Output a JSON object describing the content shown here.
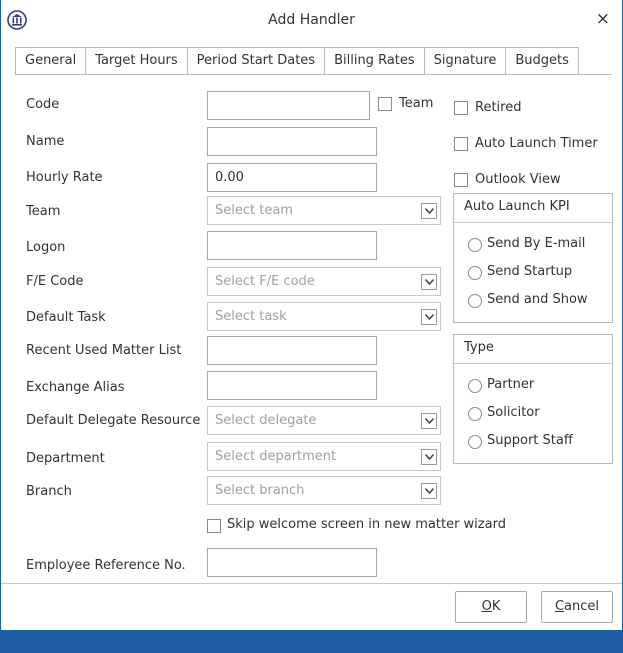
{
  "window": {
    "title": "Add Handler",
    "close_glyph": "×",
    "app_icon": "pillars-logo-icon",
    "accent_color": "#1e5ea8"
  },
  "tabs": [
    {
      "label": "General",
      "active": true
    },
    {
      "label": "Target Hours",
      "active": false
    },
    {
      "label": "Period Start Dates",
      "active": false
    },
    {
      "label": "Billing Rates",
      "active": false
    },
    {
      "label": "Signature",
      "active": false
    },
    {
      "label": "Budgets",
      "active": false
    }
  ],
  "form": {
    "code": {
      "label": "Code",
      "value": ""
    },
    "team_checkbox": {
      "label": "Team",
      "checked": false
    },
    "name": {
      "label": "Name",
      "value": ""
    },
    "hourly_rate": {
      "label": "Hourly Rate",
      "value": "0.00"
    },
    "team": {
      "label": "Team",
      "placeholder": "Select team"
    },
    "logon": {
      "label": "Logon",
      "value": ""
    },
    "fe_code": {
      "label": "F/E Code",
      "placeholder": "Select F/E code"
    },
    "default_task": {
      "label": "Default Task",
      "placeholder": "Select task"
    },
    "recent_used": {
      "label": "Recent Used Matter List",
      "value": ""
    },
    "exchange_alias": {
      "label": "Exchange Alias",
      "value": ""
    },
    "default_delegate": {
      "label": "Default Delegate Resource",
      "placeholder": "Select delegate"
    },
    "department": {
      "label": "Department",
      "placeholder": "Select department"
    },
    "branch": {
      "label": "Branch",
      "placeholder": "Select branch"
    },
    "skip_welcome": {
      "label": "Skip welcome screen in new matter wizard",
      "checked": false
    },
    "employee_ref": {
      "label": "Employee Reference No.",
      "value": ""
    }
  },
  "options": {
    "retired": {
      "label": "Retired",
      "checked": false
    },
    "auto_launch_timer": {
      "label": "Auto Launch Timer",
      "checked": false
    },
    "outlook_view": {
      "label": "Outlook View",
      "checked": false
    }
  },
  "kpi_group": {
    "title": "Auto Launch KPI",
    "options": [
      "Send By E-mail",
      "Send Startup",
      "Send and Show"
    ]
  },
  "type_group": {
    "title": "Type",
    "options": [
      "Partner",
      "Solicitor",
      "Support Staff"
    ]
  },
  "buttons": {
    "ok": {
      "mnemonic": "O",
      "rest": "K"
    },
    "cancel": {
      "mnemonic": "C",
      "rest": "ancel"
    }
  }
}
